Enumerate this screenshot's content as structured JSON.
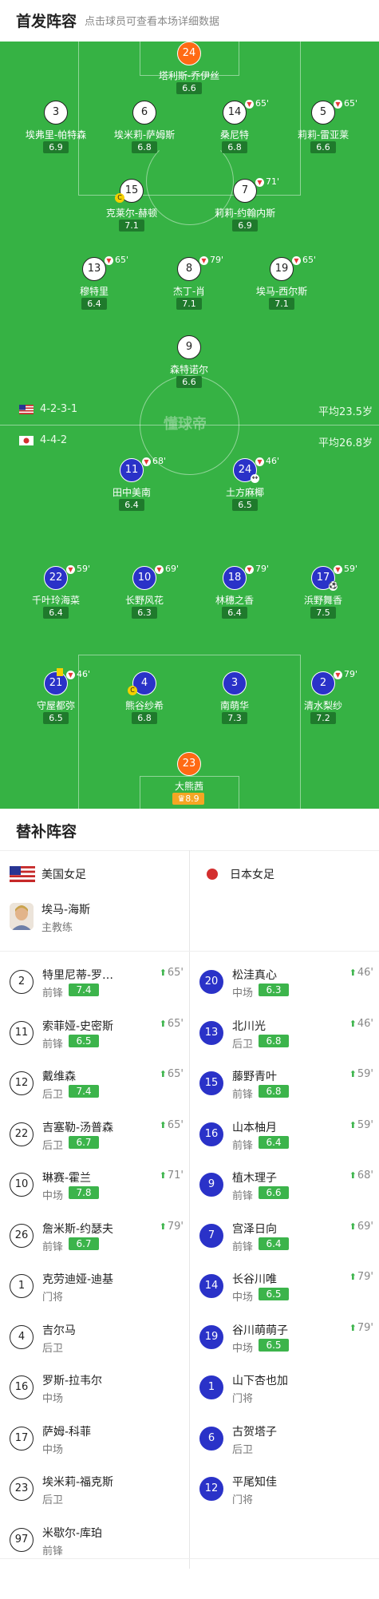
{
  "header": {
    "title": "首发阵容",
    "subtitle": "点击球员可查看本场详细数据"
  },
  "pitch": {
    "watermark": "懂球帝",
    "home": {
      "formation": "4-2-3-1",
      "avg_age": "平均23.5岁",
      "flag": "us"
    },
    "away": {
      "formation": "4-4-2",
      "avg_age": "平均26.8岁",
      "flag": "jp"
    },
    "home_players": [
      {
        "num": "24",
        "name": "塔利斯-乔伊丝",
        "rating": "6.6",
        "gk": true
      },
      {
        "num": "3",
        "name": "埃弗里-帕特森",
        "rating": "6.9"
      },
      {
        "num": "6",
        "name": "埃米莉-萨姆斯",
        "rating": "6.8"
      },
      {
        "num": "14",
        "name": "桑尼特",
        "rating": "6.8",
        "sub": "65'"
      },
      {
        "num": "5",
        "name": "莉莉-雷亚莱",
        "rating": "6.6",
        "sub": "65'"
      },
      {
        "num": "15",
        "name": "克莱尔-赫顿",
        "rating": "7.1",
        "captain": "C"
      },
      {
        "num": "7",
        "name": "莉莉-约翰内斯",
        "rating": "6.9",
        "sub": "71'"
      },
      {
        "num": "13",
        "name": "穆特里",
        "rating": "6.4",
        "sub": "65'"
      },
      {
        "num": "8",
        "name": "杰丁-肖",
        "rating": "7.1",
        "sub": "79'"
      },
      {
        "num": "19",
        "name": "埃马-西尔斯",
        "rating": "7.1",
        "sub": "65'"
      },
      {
        "num": "9",
        "name": "森特诺尔",
        "rating": "6.6"
      }
    ],
    "away_players": [
      {
        "num": "11",
        "name": "田中美南",
        "rating": "6.4",
        "sub": "68'"
      },
      {
        "num": "24",
        "name": "土方麻椰",
        "rating": "6.5",
        "sub": "46'"
      },
      {
        "num": "22",
        "name": "千叶玲海菜",
        "rating": "6.4",
        "sub": "59'"
      },
      {
        "num": "10",
        "name": "长野风花",
        "rating": "6.3",
        "sub": "69'"
      },
      {
        "num": "18",
        "name": "林穗之香",
        "rating": "6.4",
        "sub": "79'"
      },
      {
        "num": "17",
        "name": "浜野舞香",
        "rating": "7.5",
        "sub": "59'"
      },
      {
        "num": "21",
        "name": "守屋都弥",
        "rating": "6.5",
        "sub": "46'"
      },
      {
        "num": "4",
        "name": "熊谷纱希",
        "rating": "6.8",
        "captain": "C"
      },
      {
        "num": "3",
        "name": "南萌华",
        "rating": "7.3"
      },
      {
        "num": "2",
        "name": "清水梨纱",
        "rating": "7.2",
        "sub": "79'"
      },
      {
        "num": "23",
        "name": "大熊茜",
        "rating": "8.9",
        "gk": true,
        "best": "♛"
      }
    ]
  },
  "subs": {
    "title": "替补阵容",
    "home_team": "美国女足",
    "away_team": "日本女足",
    "coach": {
      "name": "埃马-海斯",
      "role": "主教练"
    },
    "home": [
      {
        "num": "2",
        "name": "特里尼蒂-罗…",
        "pos": "前锋",
        "rating": "7.4",
        "min": "65'"
      },
      {
        "num": "11",
        "name": "索菲娅-史密斯",
        "pos": "前锋",
        "rating": "6.5",
        "min": "65'"
      },
      {
        "num": "12",
        "name": "戴维森",
        "pos": "后卫",
        "rating": "7.4",
        "min": "65'"
      },
      {
        "num": "22",
        "name": "吉塞勒-汤普森",
        "pos": "后卫",
        "rating": "6.7",
        "min": "65'"
      },
      {
        "num": "10",
        "name": "琳赛-霍兰",
        "pos": "中场",
        "rating": "7.8",
        "min": "71'"
      },
      {
        "num": "26",
        "name": "詹米斯-约瑟夫",
        "pos": "前锋",
        "rating": "6.7",
        "min": "79'"
      },
      {
        "num": "1",
        "name": "克劳迪娅-迪基",
        "pos": "门将"
      },
      {
        "num": "4",
        "name": "吉尔马",
        "pos": "后卫"
      },
      {
        "num": "16",
        "name": "罗斯-拉韦尔",
        "pos": "中场"
      },
      {
        "num": "17",
        "name": "萨姆-科菲",
        "pos": "中场"
      },
      {
        "num": "23",
        "name": "埃米莉-福克斯",
        "pos": "后卫"
      },
      {
        "num": "97",
        "name": "米歇尔-库珀",
        "pos": "前锋"
      }
    ],
    "away": [
      {
        "num": "20",
        "name": "松洼真心",
        "pos": "中场",
        "rating": "6.3",
        "min": "46'"
      },
      {
        "num": "13",
        "name": "北川光",
        "pos": "后卫",
        "rating": "6.8",
        "min": "46'"
      },
      {
        "num": "15",
        "name": "藤野青叶",
        "pos": "前锋",
        "rating": "6.8",
        "min": "59'"
      },
      {
        "num": "16",
        "name": "山本柚月",
        "pos": "前锋",
        "rating": "6.4",
        "min": "59'"
      },
      {
        "num": "9",
        "name": "植木理子",
        "pos": "前锋",
        "rating": "6.6",
        "min": "68'"
      },
      {
        "num": "7",
        "name": "宫泽日向",
        "pos": "前锋",
        "rating": "6.4",
        "min": "69'"
      },
      {
        "num": "14",
        "name": "长谷川唯",
        "pos": "中场",
        "rating": "6.5",
        "min": "79'"
      },
      {
        "num": "19",
        "name": "谷川萌萌子",
        "pos": "中场",
        "rating": "6.5",
        "min": "79'"
      },
      {
        "num": "1",
        "name": "山下杏也加",
        "pos": "门将"
      },
      {
        "num": "6",
        "name": "古贺塔子",
        "pos": "后卫"
      },
      {
        "num": "12",
        "name": "平尾知佳",
        "pos": "门将"
      }
    ]
  },
  "colors": {
    "pitch": "#36b244",
    "away_circle": "#2a32c8",
    "gk": "#ff6a14",
    "rating_badge": "#3cb44b"
  }
}
